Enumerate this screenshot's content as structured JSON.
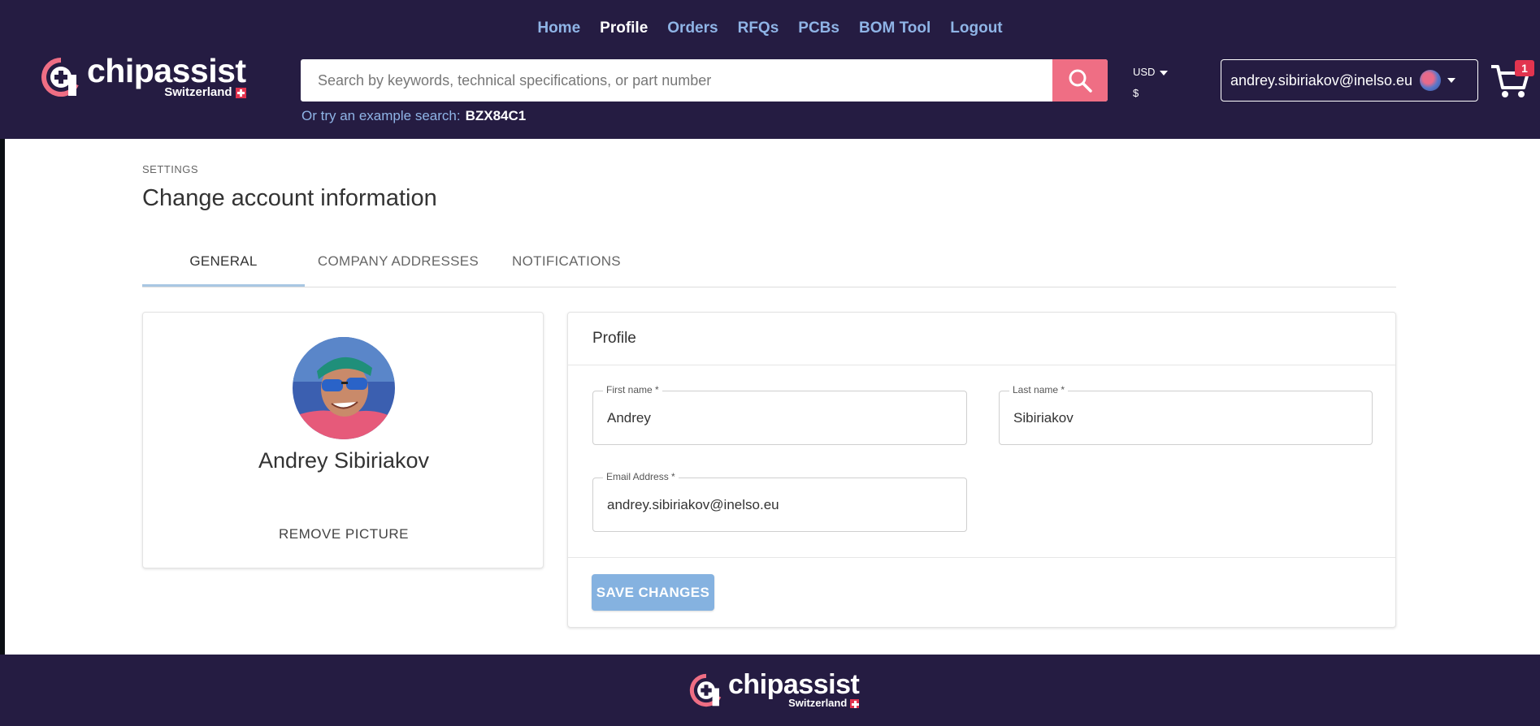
{
  "nav": {
    "items": [
      {
        "label": "Home",
        "active": false
      },
      {
        "label": "Profile",
        "active": true
      },
      {
        "label": "Orders",
        "active": false
      },
      {
        "label": "RFQs",
        "active": false
      },
      {
        "label": "PCBs",
        "active": false
      },
      {
        "label": "BOM Tool",
        "active": false
      },
      {
        "label": "Logout",
        "active": false
      }
    ]
  },
  "brand": {
    "name": "chipassist",
    "sub": "Switzerland"
  },
  "search": {
    "placeholder": "Search by keywords, technical specifications, or part number",
    "example_prefix": "Or try an example search:",
    "example_value": "BZX84C1"
  },
  "currency": {
    "code": "USD",
    "symbol": "$"
  },
  "account": {
    "email": "andrey.sibiriakov@inelso.eu"
  },
  "cart": {
    "count": "1"
  },
  "page": {
    "breadcrumb": "SETTINGS",
    "title": "Change account information"
  },
  "tabs": [
    {
      "label": "GENERAL",
      "active": true
    },
    {
      "label": "COMPANY ADDRESSES",
      "active": false
    },
    {
      "label": "NOTIFICATIONS",
      "active": false
    }
  ],
  "profile_card": {
    "name": "Andrey Sibiriakov",
    "remove_label": "REMOVE PICTURE"
  },
  "form": {
    "heading": "Profile",
    "first_name": {
      "label": "First name *",
      "value": "Andrey"
    },
    "last_name": {
      "label": "Last name *",
      "value": "Sibiriakov"
    },
    "email": {
      "label": "Email Address *",
      "value": "andrey.sibiriakov@inelso.eu"
    },
    "save_label": "SAVE CHANGES"
  },
  "colors": {
    "header_bg": "#251c42",
    "nav_link": "#8fb4e6",
    "accent_pink": "#ef6e84",
    "save_button": "#85b2e0"
  }
}
